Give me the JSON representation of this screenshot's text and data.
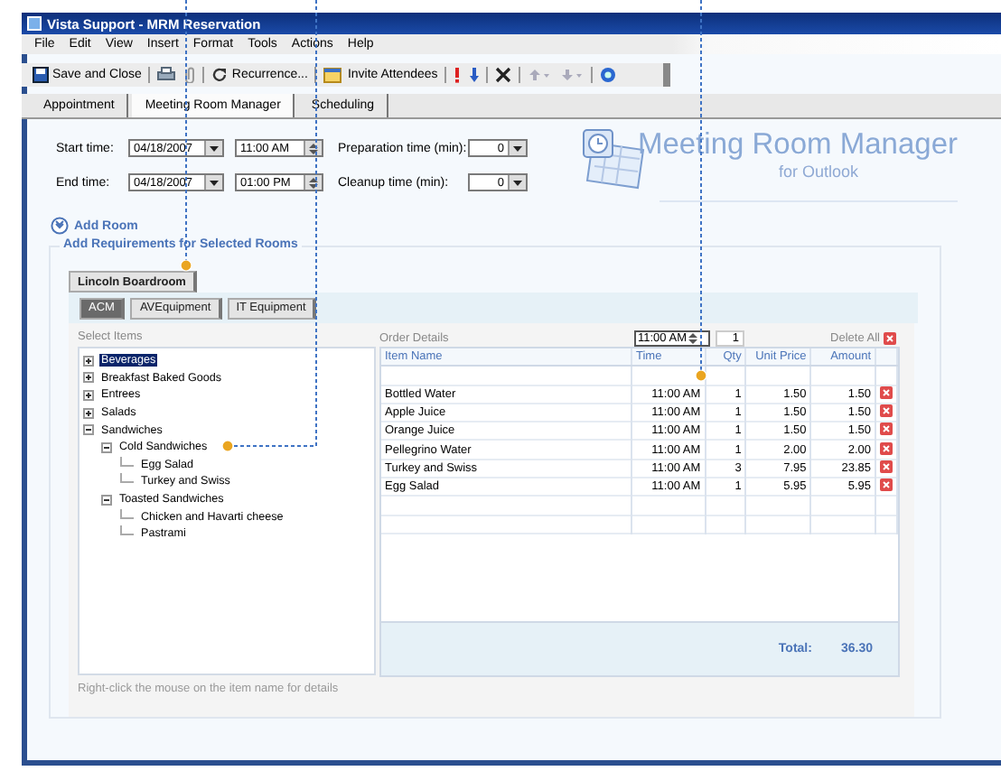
{
  "window": {
    "title": "Vista Support - MRM Reservation"
  },
  "menu": [
    "File",
    "Edit",
    "View",
    "Insert",
    "Format",
    "Tools",
    "Actions",
    "Help"
  ],
  "toolbar": [
    {
      "kind": "save",
      "label": "Save and Close"
    },
    {
      "kind": "print"
    },
    {
      "kind": "attach"
    },
    {
      "kind": "recurrence",
      "label": "Recurrence..."
    },
    {
      "kind": "invite",
      "label": "Invite Attendees"
    },
    {
      "kind": "high"
    },
    {
      "kind": "low"
    },
    {
      "kind": "delete"
    },
    {
      "kind": "prev"
    },
    {
      "kind": "next"
    },
    {
      "kind": "help"
    }
  ],
  "tabs": [
    {
      "label": "Appointment",
      "selected": false
    },
    {
      "label": "Meeting Room Manager",
      "selected": true
    },
    {
      "label": "Scheduling",
      "selected": false
    }
  ],
  "times": [
    {
      "label": "Start time:",
      "date": "04/18/2007",
      "time": "11:00 AM",
      "extra_label": "Preparation time (min):",
      "extra_value": "0"
    },
    {
      "label": "End time:",
      "date": "04/18/2007",
      "time": "01:00 PM",
      "extra_label": "Cleanup time (min):",
      "extra_value": "0"
    }
  ],
  "logo": {
    "title": "Meeting Room Manager",
    "subtitle": "for Outlook"
  },
  "add_room": "Add Room",
  "requirements": {
    "title": "Add Requirements for Selected Rooms",
    "rooms": [
      {
        "label": "Lincoln Boardroom",
        "selected": true
      }
    ],
    "categories": [
      {
        "label": "ACM",
        "selected": true
      },
      {
        "label": "AVEquipment",
        "selected": false
      },
      {
        "label": "IT Equipment",
        "selected": false
      }
    ],
    "select_label": "Select Items",
    "tree": [
      {
        "label": "Beverages",
        "expanded": false,
        "selected": true
      },
      {
        "label": "Breakfast Baked Goods",
        "expanded": false,
        "selected": false
      },
      {
        "label": "Entrees",
        "expanded": false,
        "selected": false
      },
      {
        "label": "Salads",
        "expanded": false,
        "selected": false
      },
      {
        "label": "Sandwiches",
        "expanded": true,
        "selected": false,
        "children": [
          {
            "label": "Cold Sandwiches",
            "expanded": true,
            "selected": false,
            "children": [
              {
                "label": "Egg Salad",
                "selected": false
              },
              {
                "label": "Turkey and Swiss",
                "selected": false
              }
            ]
          },
          {
            "label": "Toasted Sandwiches",
            "expanded": true,
            "selected": false,
            "children": [
              {
                "label": "Chicken and Havarti cheese",
                "selected": false
              },
              {
                "label": "Pastrami",
                "selected": false
              }
            ]
          }
        ]
      }
    ],
    "order": {
      "label": "Order Details",
      "time": "11:00 AM",
      "qty": "1",
      "delete_all": "Delete All",
      "columns": [
        "Item Name",
        "Time",
        "Qty",
        "Unit Price",
        "Amount"
      ],
      "rows": [
        [
          "Bottled Water",
          "11:00 AM",
          "1",
          "1.50",
          "1.50"
        ],
        [
          "Apple Juice",
          "11:00 AM",
          "1",
          "1.50",
          "1.50"
        ],
        [
          "Orange Juice",
          "11:00 AM",
          "1",
          "1.50",
          "1.50"
        ],
        [
          "Pellegrino Water",
          "11:00 AM",
          "1",
          "2.00",
          "2.00"
        ],
        [
          "Turkey and Swiss",
          "11:00 AM",
          "3",
          "7.95",
          "23.85"
        ],
        [
          "Egg Salad",
          "11:00 AM",
          "1",
          "5.95",
          "5.95"
        ]
      ],
      "total_label": "Total:",
      "total": "36.30"
    },
    "hint": "Right-click the mouse on the item name for details"
  }
}
